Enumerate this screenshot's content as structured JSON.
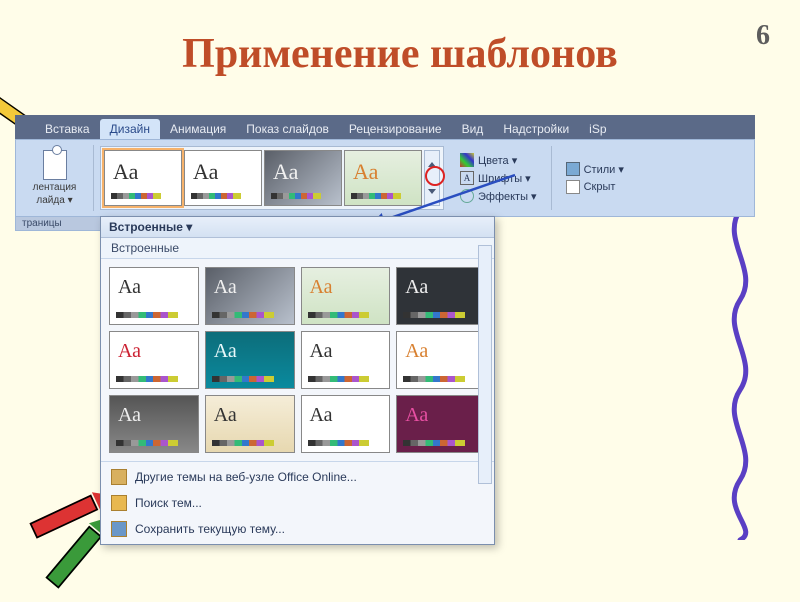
{
  "slide_number": "6",
  "title": "Применение шаблонов",
  "ribbon": {
    "tabs": {
      "t0": "Вставка",
      "t1_active": "Дизайн",
      "t2": "Анимация",
      "t3": "Показ слайдов",
      "t4": "Рецензирование",
      "t5": "Вид",
      "t6": "Надстройки",
      "t7": "iSp"
    },
    "orientation": {
      "line1": "лентация",
      "line2": "лайда ▾"
    },
    "page_setup_group": "траницы",
    "themes_visible": [
      {
        "aa": "Аа"
      },
      {
        "aa": "Аа"
      },
      {
        "aa": "Аа"
      },
      {
        "aa": "Аа"
      }
    ],
    "colors_btn": "Цвета ▾",
    "fonts_btn": "Шрифты ▾",
    "effects_btn": "Эффекты ▾",
    "bg_styles_btn": "Стили ▾",
    "bg_hide_chk": "Скрыт"
  },
  "dropdown": {
    "header": "Встроенные ▾",
    "section": "Встроенные",
    "thumbs": [
      {
        "aa": "Аа",
        "bg": "bg-white",
        "col": "col-dark"
      },
      {
        "aa": "Аа",
        "bg": "bg-grad-gray",
        "col": "col-white"
      },
      {
        "aa": "Аа",
        "bg": "bg-green",
        "col": "col-orange"
      },
      {
        "aa": "Аа",
        "bg": "bg-dark",
        "col": "col-gray"
      },
      {
        "aa": "Аа",
        "bg": "bg-white",
        "col": "col-red"
      },
      {
        "aa": "Аа",
        "bg": "bg-teal",
        "col": "col-teal"
      },
      {
        "aa": "Аа",
        "bg": "bg-white",
        "col": "col-dark"
      },
      {
        "aa": "Аа",
        "bg": "bg-white",
        "col": "col-orange"
      },
      {
        "aa": "Аа",
        "bg": "bg-gray",
        "col": "col-gray"
      },
      {
        "aa": "Аа",
        "bg": "bg-tan",
        "col": "col-dark"
      },
      {
        "aa": "Аа",
        "bg": "bg-white",
        "col": "col-dark"
      },
      {
        "aa": "Аа",
        "bg": "bg-mag",
        "col": "col-pink"
      }
    ],
    "more_online": "Другие темы на веб-узле Office Online...",
    "search_themes": "Поиск тем...",
    "save_theme": "Сохранить текущую тему..."
  }
}
